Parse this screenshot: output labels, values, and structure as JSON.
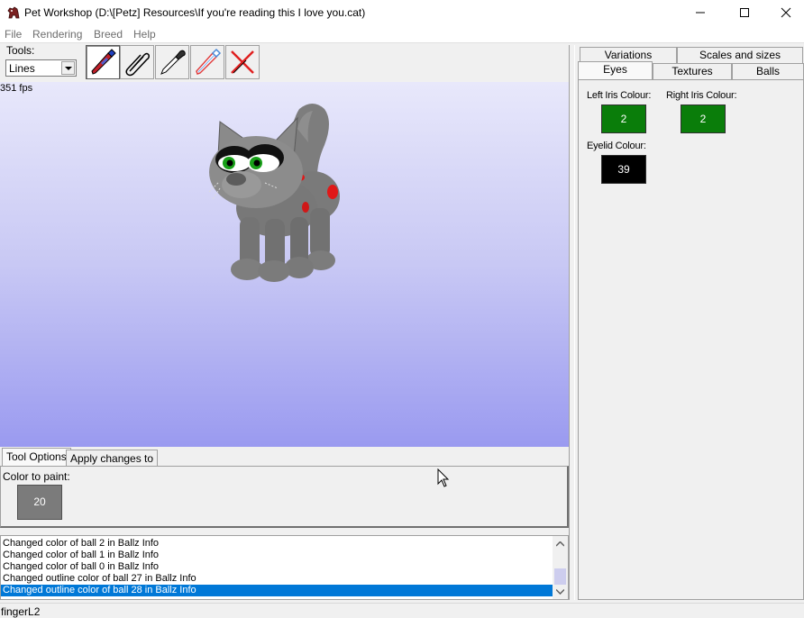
{
  "window": {
    "title": "Pet Workshop (D:\\[Petz] Resources\\If you're reading this I love you.cat)",
    "app_icon": "dog-icon",
    "controls": [
      "minimize-icon",
      "maximize-icon",
      "close-icon"
    ]
  },
  "menu": [
    "File",
    "Rendering",
    "Breed",
    "Help"
  ],
  "toolbar": {
    "tools_label": "Tools:",
    "tool_mode": "Lines",
    "tools": [
      {
        "name": "paint-brush-tool",
        "icon": "brush-icon",
        "active": true
      },
      {
        "name": "paperclip-tool",
        "icon": "paperclip-icon",
        "active": false
      },
      {
        "name": "eyedropper-tool",
        "icon": "eyedropper-icon",
        "active": false
      },
      {
        "name": "outline-brush-tool",
        "icon": "brush-outline-icon",
        "active": false
      },
      {
        "name": "delete-tool",
        "icon": "red-x-icon",
        "active": false
      }
    ]
  },
  "viewport": {
    "fps": "351 fps"
  },
  "lower_tabs": {
    "tabs": [
      "Tool Options",
      "Apply changes to"
    ],
    "active": "Tool Options"
  },
  "tool_options": {
    "color_label": "Color to paint:",
    "color_value": "20",
    "color_hex": "#7b7b7b"
  },
  "log": {
    "entries": [
      "Changed color of ball 2 in Ballz Info",
      "Changed color of ball 1 in Ballz Info",
      "Changed color of ball 0 in Ballz Info",
      "Changed outline color of ball 27 in Ballz Info",
      "Changed outline color of ball 28 in Ballz Info"
    ],
    "selected_index": 4,
    "selected_color": "#0078d7"
  },
  "status": {
    "text": "fingerL2"
  },
  "right_panel": {
    "tabs_row1": [
      "Variations",
      "Scales and sizes"
    ],
    "tabs_row2": [
      "Eyes",
      "Textures",
      "Balls"
    ],
    "active_tab": "Eyes",
    "left_iris_label": "Left Iris Colour:",
    "left_iris_value": "2",
    "right_iris_label": "Right Iris Colour:",
    "right_iris_value": "2",
    "eyelid_label": "Eyelid Colour:",
    "eyelid_value": "39",
    "iris_color_hex": "#0a7d0a",
    "eyelid_color_hex": "#000000"
  }
}
